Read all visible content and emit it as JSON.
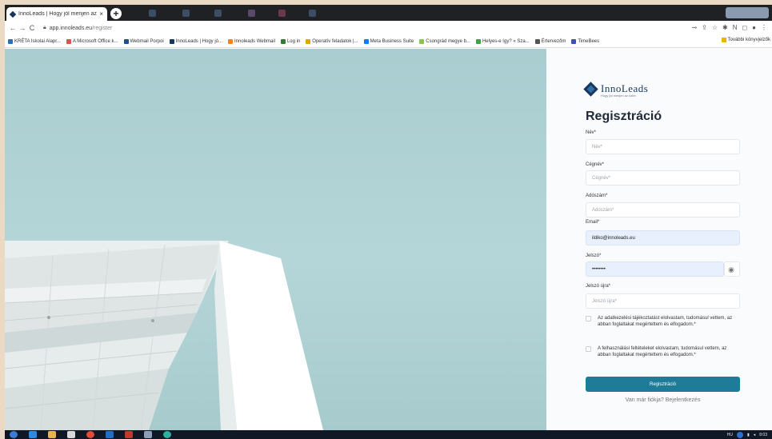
{
  "browser": {
    "tab_title": "InnoLeads | Hogy jól menjen az ...",
    "tab_close": "×",
    "new_tab": "+",
    "url_host": "app.innoleads.eu",
    "url_path": "/register",
    "nav": {
      "back": "←",
      "forward": "→",
      "reload": "C"
    }
  },
  "bookmarks": [
    {
      "label": "KRÉTA Iskolai Alapr...",
      "color": "#2a6fb5"
    },
    {
      "label": "A Microsoft Office k...",
      "color": "#d9534f"
    },
    {
      "label": "Webmail Porpoi",
      "color": "#1d4f91"
    },
    {
      "label": "InnoLeads | Hogy jó...",
      "color": "#17375e"
    },
    {
      "label": "Innoleads Webmail",
      "color": "#f58220"
    },
    {
      "label": "Log in",
      "color": "#2e7d32"
    },
    {
      "label": "Operatív feladatok |...",
      "color": "#e0a800"
    },
    {
      "label": "Meta Business Suite",
      "color": "#1877f2"
    },
    {
      "label": "Csongrád megye b...",
      "color": "#8bc34a"
    },
    {
      "label": "Helyes-e így? « Sza...",
      "color": "#43a047"
    },
    {
      "label": "Értervezőm",
      "color": "#555555"
    },
    {
      "label": "TimeBees",
      "color": "#3f51b5"
    }
  ],
  "bookmarks_other": "További könyvjelzők",
  "brand": {
    "name": "InnoLeads",
    "tagline": "Hogy jól menjen az üzlet"
  },
  "form": {
    "title": "Regisztráció",
    "name_label": "Név*",
    "name_placeholder": "Név*",
    "company_label": "Cégnév*",
    "company_placeholder": "Cégnév*",
    "tax_label": "Adószám*",
    "tax_placeholder": "Adószám*",
    "email_label": "Email*",
    "email_value": "ildiko@innoleads.eu",
    "password_label": "Jelszó*",
    "password_value": "••••••••",
    "password2_label": "Jelszó újra*",
    "password2_placeholder": "Jelszó újra*",
    "consent_privacy": "Az adatkezelési tájékoztatást elolvastam, tudomásul vettem, az abban foglaltakat megértettem és elfogadom.*",
    "consent_terms": "A felhasználási feltételeket elolvastam, tudomásul vettem, az abban foglaltakat megértettem és elfogadom.*",
    "submit_label": "Regisztráció",
    "login_text": "Van már fiókja? Bejelentkezés"
  },
  "taskbar": {
    "lang": "HU",
    "time": "8:03"
  }
}
